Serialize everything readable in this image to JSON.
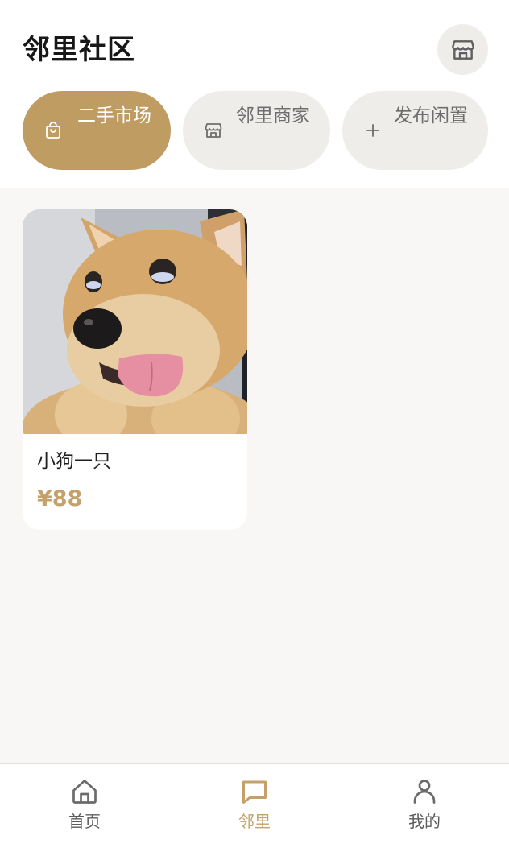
{
  "header": {
    "title": "邻里社区",
    "shop_icon": "storefront-icon"
  },
  "tabs": [
    {
      "label": "二手市场",
      "icon": "shopping-bag-icon",
      "active": true
    },
    {
      "label": "邻里商家",
      "icon": "storefront-icon",
      "active": false
    },
    {
      "label": "发布闲置",
      "icon": "plus-icon",
      "active": false
    }
  ],
  "listings": [
    {
      "title": "小狗一只",
      "price": "¥88",
      "image": "shiba-puppy-photo"
    }
  ],
  "bottom_nav": [
    {
      "label": "首页",
      "icon": "home-icon",
      "active": false
    },
    {
      "label": "邻里",
      "icon": "chat-bubble-icon",
      "active": true
    },
    {
      "label": "我的",
      "icon": "user-icon",
      "active": false
    }
  ],
  "colors": {
    "accent": "#bf9c62",
    "price": "#c4a06a",
    "pill_inactive": "#efedea",
    "background": "#f8f7f5"
  }
}
